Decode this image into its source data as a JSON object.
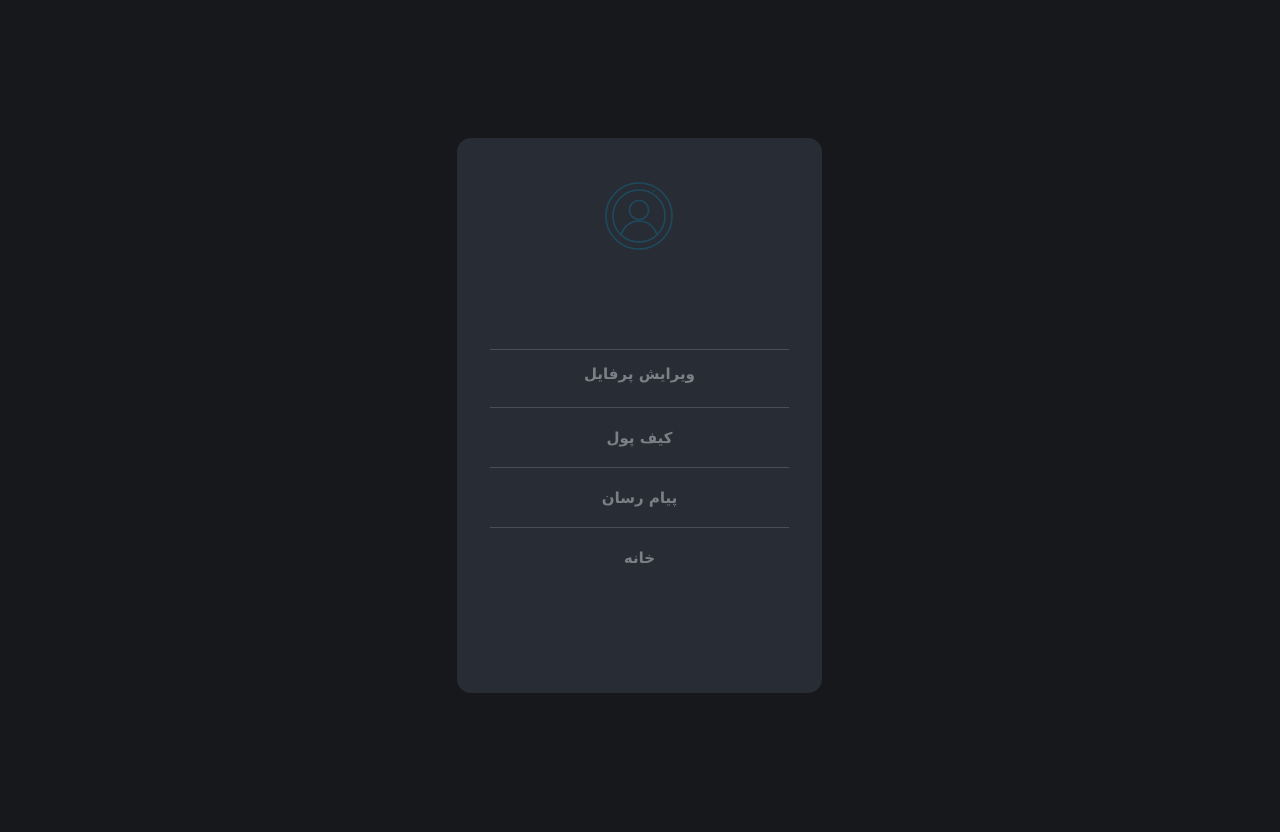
{
  "profile": {
    "avatar_icon": "user-circle-icon",
    "avatar_color": "#1f4a5e"
  },
  "menu": {
    "items": [
      {
        "label": "ویرایش پرفایل"
      },
      {
        "label": "کیف پول"
      },
      {
        "label": "پیام رسان"
      },
      {
        "label": "خانه"
      }
    ]
  },
  "colors": {
    "background": "#17181c",
    "card": "#282c34",
    "divider": "#4a4e56",
    "text": "#7b7f86"
  }
}
